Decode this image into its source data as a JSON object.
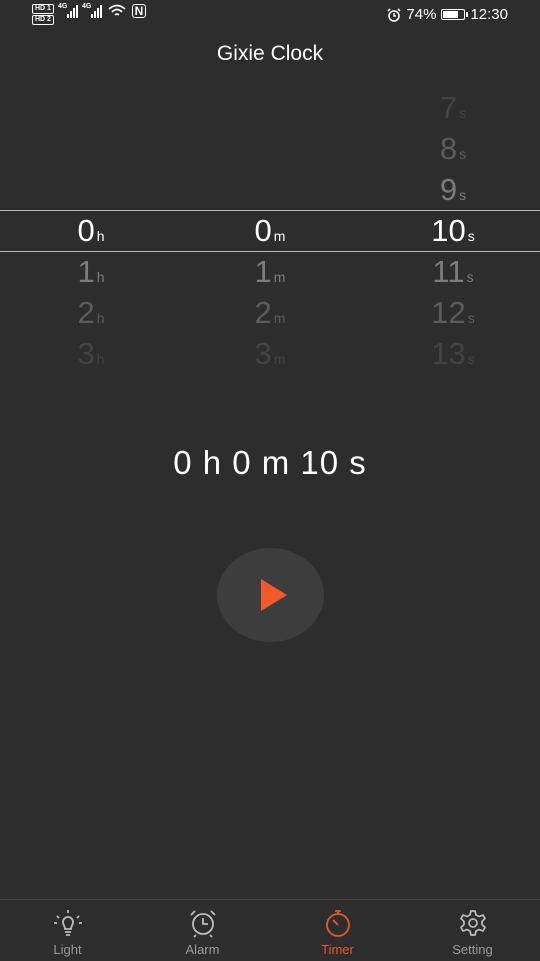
{
  "status_bar": {
    "hd1": "HD 1",
    "hd2": "HD 2",
    "sim1": "4G",
    "sim2": "4G",
    "nfc": "N",
    "battery": "74%",
    "battery_level": 0.74,
    "time": "12:30"
  },
  "app": {
    "title": "Gixie Clock"
  },
  "picker": {
    "hours": {
      "unit": "h",
      "selected": "0",
      "items": [
        "0",
        "1",
        "2",
        "3"
      ]
    },
    "minutes": {
      "unit": "m",
      "selected": "0",
      "items": [
        "0",
        "1",
        "2",
        "3"
      ]
    },
    "seconds": {
      "unit": "s",
      "selected": "10",
      "above": [
        "7",
        "8",
        "9"
      ],
      "items": [
        "10",
        "11",
        "12",
        "13"
      ]
    }
  },
  "summary": "0 h 0 m 10 s",
  "controls": {
    "play_icon": "play-icon",
    "accent": "#f05a2b"
  },
  "nav": {
    "items": [
      {
        "label": "Light",
        "icon": "light-bulb-icon",
        "active": false
      },
      {
        "label": "Alarm",
        "icon": "alarm-clock-icon",
        "active": false
      },
      {
        "label": "Timer",
        "icon": "timer-icon",
        "active": true
      },
      {
        "label": "Setting",
        "icon": "gear-icon",
        "active": false
      }
    ],
    "active_color": "#e8582a"
  }
}
